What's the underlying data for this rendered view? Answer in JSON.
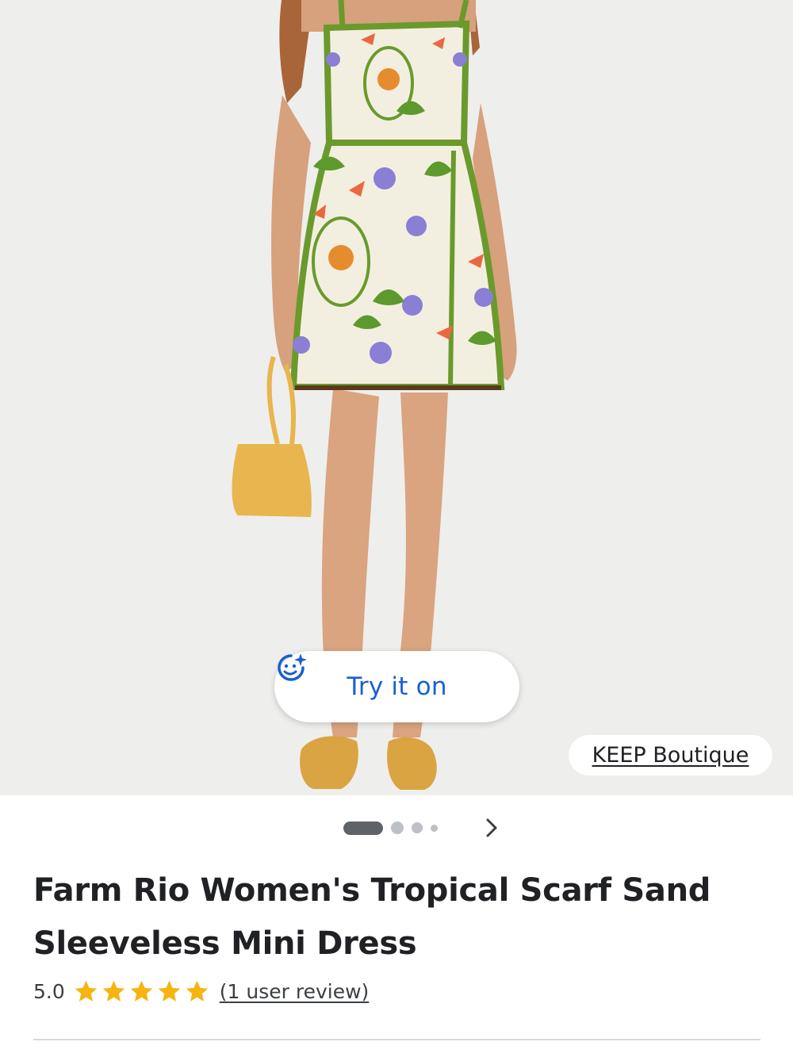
{
  "product": {
    "image_alt": "Model wearing tropical print mini dress",
    "try_on_label": "Try it on",
    "try_on_icon": "sparkle-face-icon",
    "merchant": "KEEP Boutique",
    "carousel": {
      "total": 4,
      "current": 1
    },
    "title_line1": "Farm Rio Women's Tropical Scarf Sand",
    "title_line2": "Sleeveless Mini Dress",
    "rating": "5.0",
    "stars": 5,
    "review_text": "(1 user review)"
  },
  "colors": {
    "accent_blue": "#1a5fd1",
    "star_yellow": "#f6b40e",
    "background": "#eeeeec"
  }
}
